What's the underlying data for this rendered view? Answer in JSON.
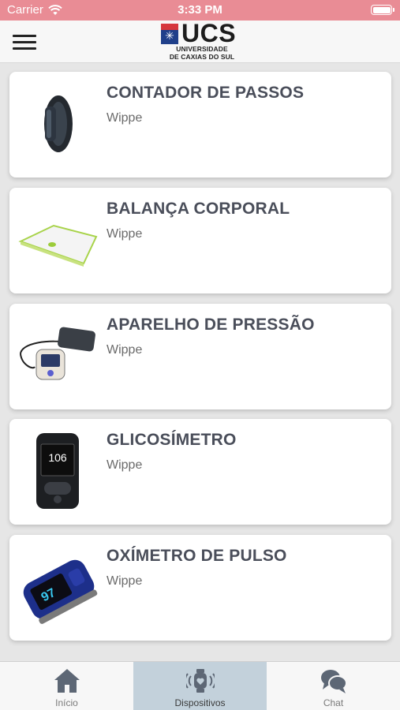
{
  "status_bar": {
    "carrier": "Carrier",
    "time": "3:33 PM"
  },
  "header": {
    "logo_text": "UCS",
    "logo_subtitle_line1": "UNIVERSIDADE",
    "logo_subtitle_line2": "DE CAXIAS DO SUL",
    "menu_icon": "hamburger-menu-icon"
  },
  "devices": [
    {
      "title": "CONTADOR DE PASSOS",
      "brand": "Wippe",
      "icon": "step-counter-band"
    },
    {
      "title": "BALANÇA CORPORAL",
      "brand": "Wippe",
      "icon": "body-scale"
    },
    {
      "title": "APARELHO DE PRESSÃO",
      "brand": "Wippe",
      "icon": "blood-pressure-monitor"
    },
    {
      "title": "GLICOSÍMETRO",
      "brand": "Wippe",
      "icon": "glucometer",
      "display_value": "106"
    },
    {
      "title": "OXÍMETRO DE PULSO",
      "brand": "Wippe",
      "icon": "pulse-oximeter",
      "display_value": "97"
    }
  ],
  "tabs": [
    {
      "label": "Início",
      "icon": "home-icon",
      "active": false
    },
    {
      "label": "Dispositivos",
      "icon": "smartwatch-icon",
      "active": true
    },
    {
      "label": "Chat",
      "icon": "chat-bubbles-icon",
      "active": false
    }
  ],
  "colors": {
    "status_bar": "#e98c95",
    "active_tab": "#c3d1db",
    "title_text": "#4a4e5a",
    "logo_blue": "#1f3f8a",
    "logo_red": "#d6373d"
  }
}
